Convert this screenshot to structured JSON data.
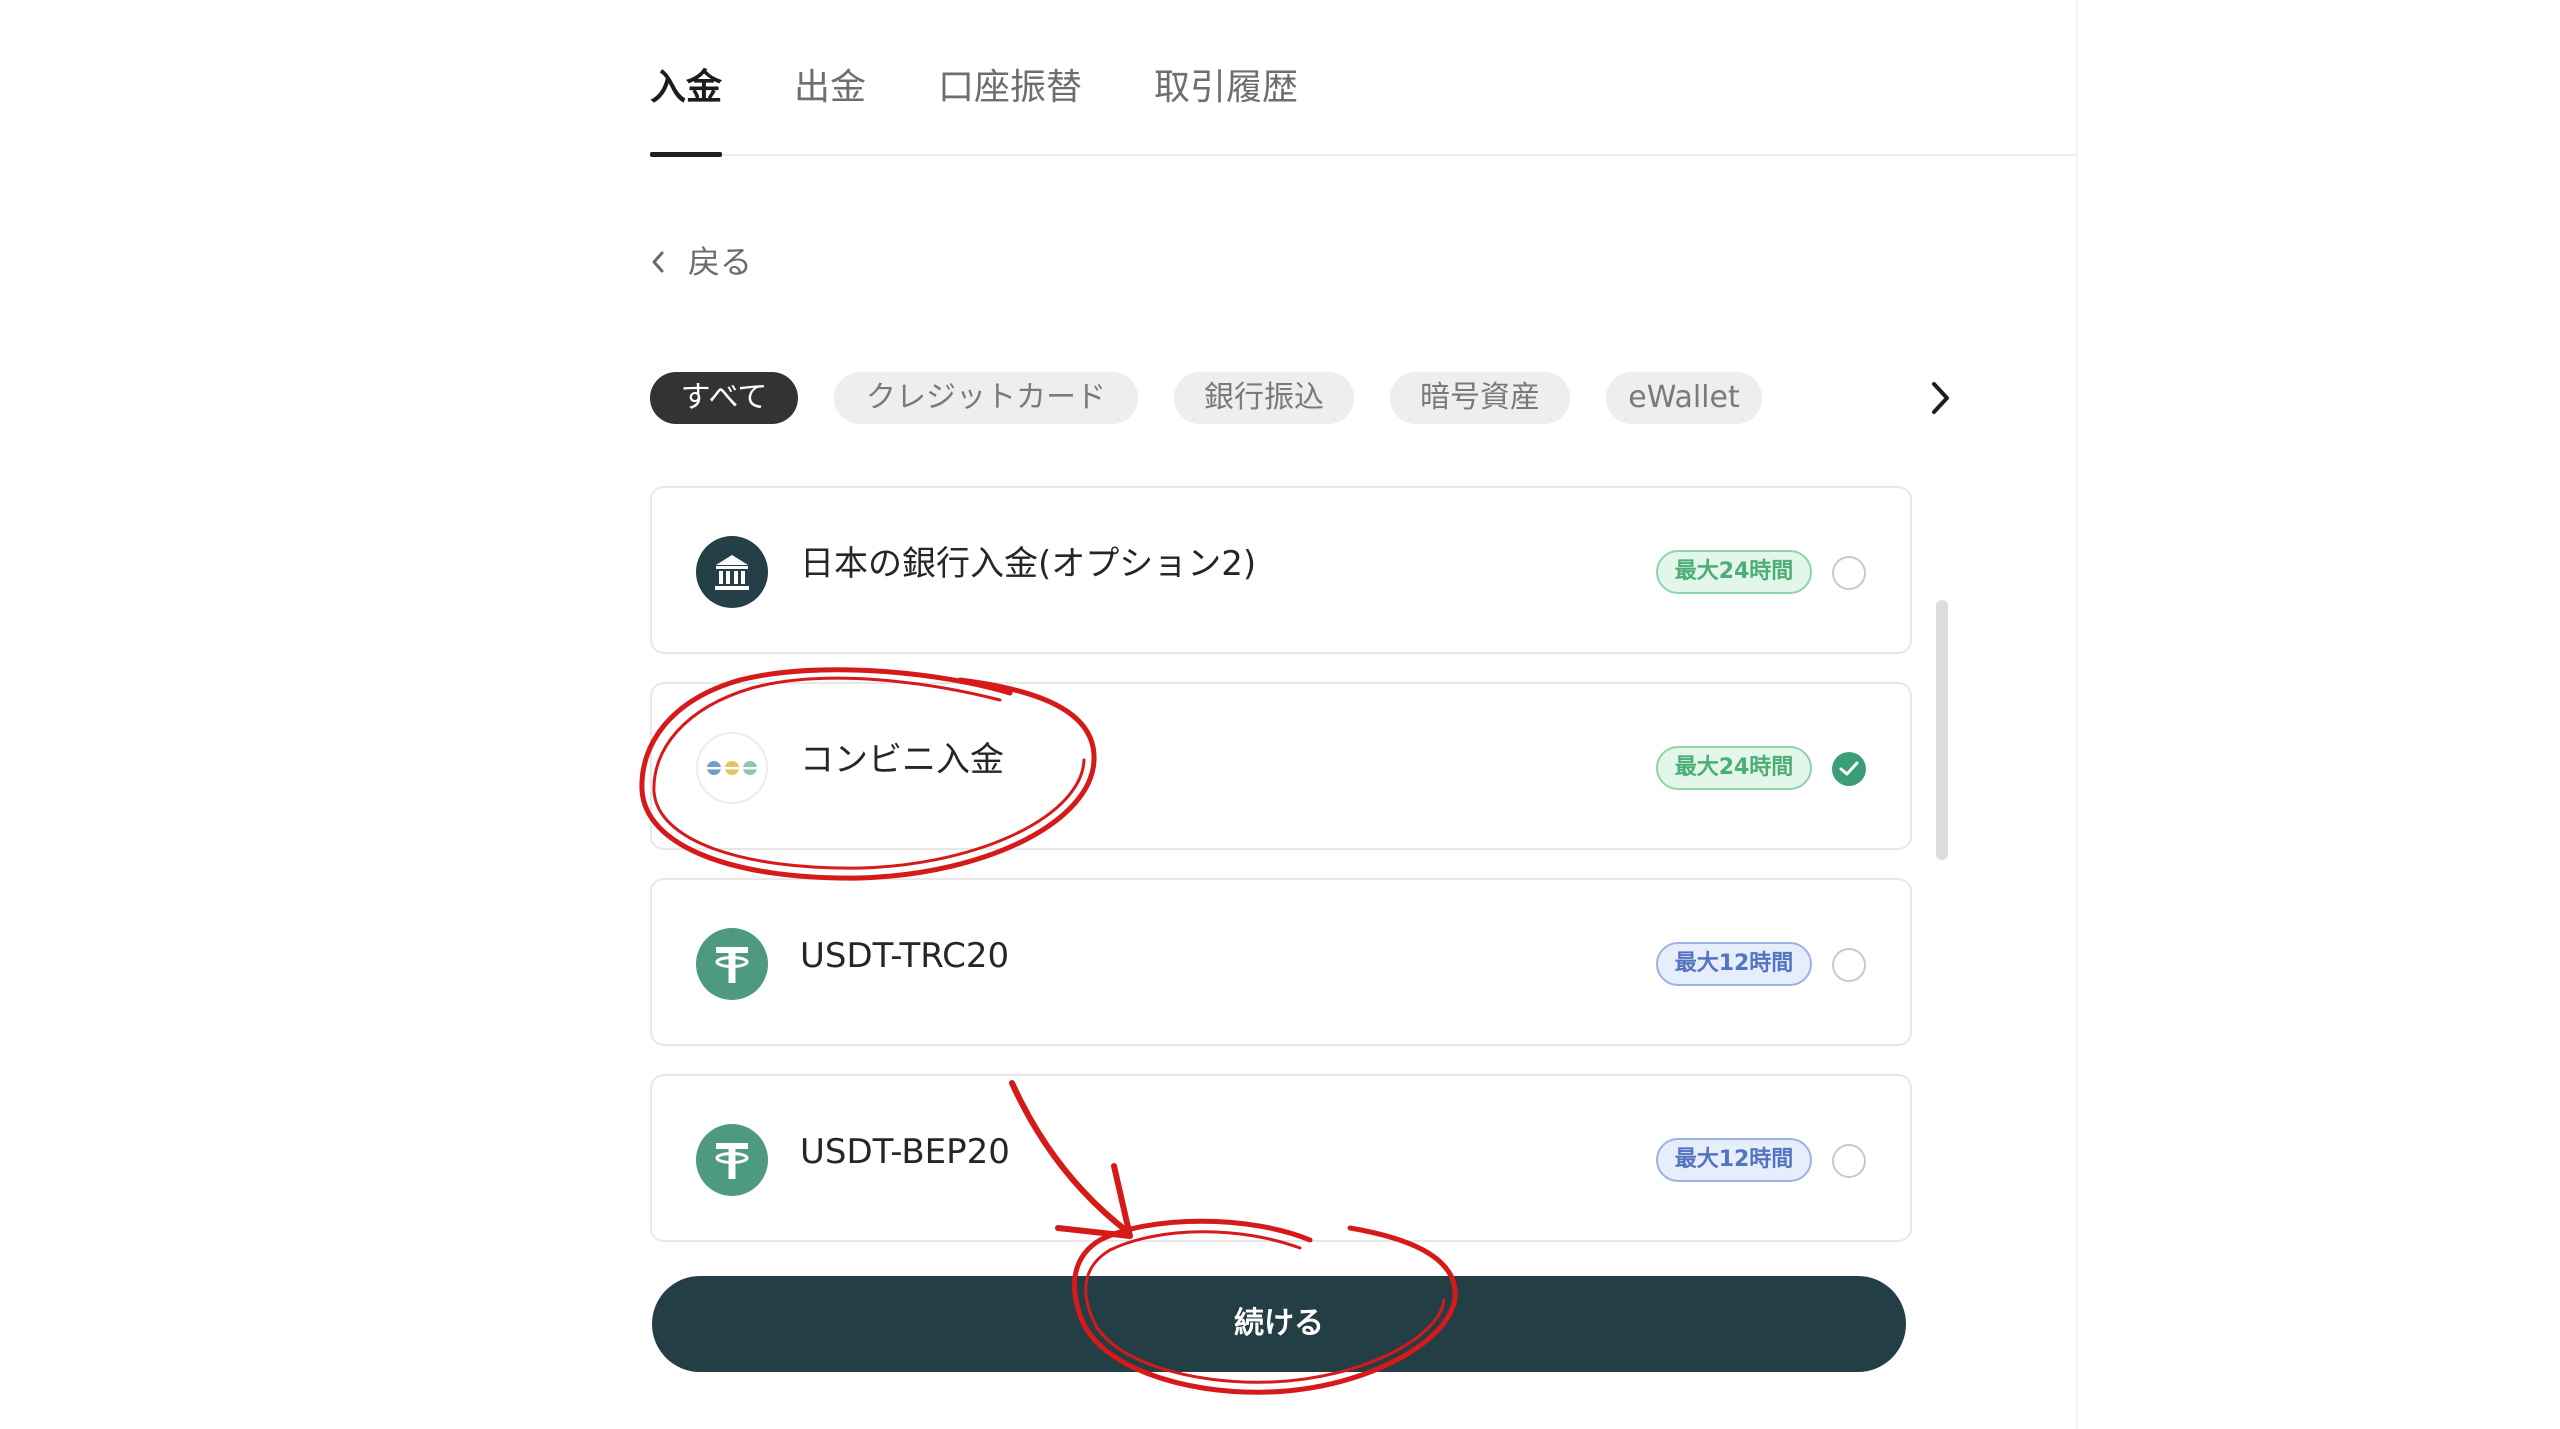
{
  "tabs": [
    {
      "label": "入金",
      "active": true
    },
    {
      "label": "出金",
      "active": false
    },
    {
      "label": "口座振替",
      "active": false
    },
    {
      "label": "取引履歴",
      "active": false
    }
  ],
  "back": {
    "label": "戻る",
    "icon": "chevron-left-icon"
  },
  "filters": {
    "chips": [
      "すべて",
      "クレジットカード",
      "銀行振込",
      "暗号資産",
      "eWallet"
    ],
    "active_index": 0,
    "next_icon": "chevron-right-icon"
  },
  "methods": [
    {
      "name": "日本の銀行入金(オプション2)",
      "badge": "最大24時間",
      "badge_tone": "green",
      "selected": false,
      "icon": "bank-icon"
    },
    {
      "name": "コンビニ入金",
      "badge": "最大24時間",
      "badge_tone": "green",
      "selected": true,
      "icon": "convenience-store-icon"
    },
    {
      "name": "USDT-TRC20",
      "badge": "最大12時間",
      "badge_tone": "blue",
      "selected": false,
      "icon": "tether-icon"
    },
    {
      "name": "USDT-BEP20",
      "badge": "最大12時間",
      "badge_tone": "blue",
      "selected": false,
      "icon": "tether-icon"
    }
  ],
  "continue_button": {
    "label": "続ける"
  },
  "colors": {
    "primary": "#233e44",
    "badge_green": "#4cae76",
    "badge_blue": "#5374c0",
    "selected_check": "#3b9e76",
    "tether": "#4d9a7e",
    "annotation_red": "#d61a1a"
  }
}
